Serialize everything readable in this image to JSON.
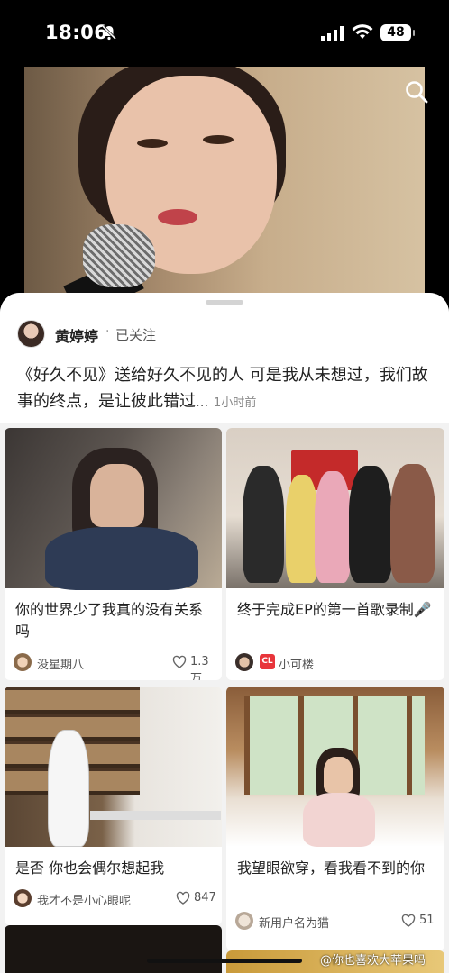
{
  "status_bar": {
    "time": "18:06",
    "battery": "48"
  },
  "post": {
    "author": "黄婷婷",
    "separator": "·",
    "follow_status": "已关注",
    "description": "《好久不见》送给好久不见的人 可是我从未想过，我们故事的终点，是让彼此错过",
    "ellipsis": "...",
    "time_ago": "1小时前"
  },
  "cards": [
    {
      "title": "你的世界少了我真的没有关系吗",
      "user": "没星期八",
      "likes": "1.3万"
    },
    {
      "title": "终于完成EP的第一首歌录制🎤",
      "user": "小可楼",
      "badge": "CL",
      "likes": ""
    },
    {
      "title": "是否 你也会偶尔想起我",
      "user": "我才不是小心眼呢",
      "likes": "847"
    },
    {
      "title": "我望眼欲穿，看我看不到的你",
      "user": "新用户名为猫",
      "likes": "51"
    }
  ],
  "watermark": "@你也喜欢大苹果吗",
  "icons": {
    "bell": "bell-muted-icon",
    "signal": "signal-icon",
    "wifi": "wifi-icon",
    "search": "search-icon",
    "heart": "heart-outline-icon"
  },
  "colors": {
    "accent_badge": "#e8353b",
    "text": "#222222",
    "sheet_bg": "#f2f2f2"
  }
}
